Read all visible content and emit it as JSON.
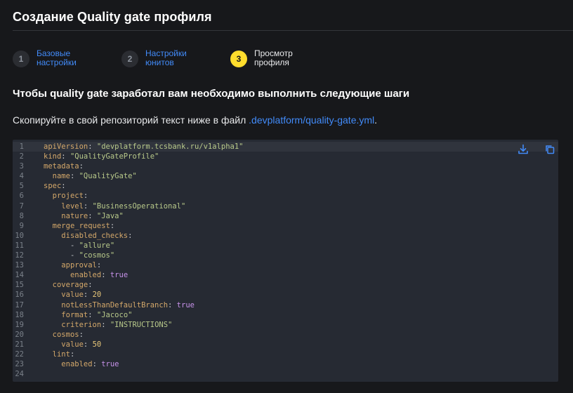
{
  "page": {
    "title": "Создание Quality gate профиля"
  },
  "stepper": {
    "steps": [
      {
        "number": "1",
        "label": "Базовые\nнастройки",
        "state": "completed"
      },
      {
        "number": "2",
        "label": "Настройки\nюнитов",
        "state": "completed"
      },
      {
        "number": "3",
        "label": "Просмотр\nпрофиля",
        "state": "active"
      }
    ]
  },
  "content": {
    "heading": "Чтобы quality gate заработал вам необходимо выполнить следующие шаги",
    "instruction_prefix": "Скопируйте в свой репозиторий текст ниже в файл ",
    "file_link": ".devplatform/quality-gate.yml",
    "instruction_suffix": "."
  },
  "code_block": {
    "actions": [
      {
        "name": "download-icon"
      },
      {
        "name": "copy-icon"
      }
    ],
    "lines": [
      {
        "n": "1",
        "indent": "",
        "key": "apiVersion",
        "value": "\"devplatform.tcsbank.ru/v1alpha1\"",
        "vtype": "s"
      },
      {
        "n": "2",
        "indent": "",
        "key": "kind",
        "value": "\"QualityGateProfile\"",
        "vtype": "s"
      },
      {
        "n": "3",
        "indent": "",
        "key": "metadata",
        "value": "",
        "vtype": ""
      },
      {
        "n": "4",
        "indent": "  ",
        "key": "name",
        "value": "\"QualityGate\"",
        "vtype": "s"
      },
      {
        "n": "5",
        "indent": "",
        "key": "spec",
        "value": "",
        "vtype": ""
      },
      {
        "n": "6",
        "indent": "  ",
        "key": "project",
        "value": "",
        "vtype": ""
      },
      {
        "n": "7",
        "indent": "    ",
        "key": "level",
        "value": "\"BusinessOperational\"",
        "vtype": "s"
      },
      {
        "n": "8",
        "indent": "    ",
        "key": "nature",
        "value": "\"Java\"",
        "vtype": "s"
      },
      {
        "n": "9",
        "indent": "  ",
        "key": "merge_request",
        "value": "",
        "vtype": ""
      },
      {
        "n": "10",
        "indent": "    ",
        "key": "disabled_checks",
        "value": "",
        "vtype": ""
      },
      {
        "n": "11",
        "indent": "      ",
        "key": "",
        "value": "\"allure\"",
        "vtype": "s",
        "item": true
      },
      {
        "n": "12",
        "indent": "      ",
        "key": "",
        "value": "\"cosmos\"",
        "vtype": "s",
        "item": true
      },
      {
        "n": "13",
        "indent": "    ",
        "key": "approval",
        "value": "",
        "vtype": ""
      },
      {
        "n": "14",
        "indent": "      ",
        "key": "enabled",
        "value": "true",
        "vtype": "b"
      },
      {
        "n": "15",
        "indent": "  ",
        "key": "coverage",
        "value": "",
        "vtype": ""
      },
      {
        "n": "16",
        "indent": "    ",
        "key": "value",
        "value": "20",
        "vtype": "n"
      },
      {
        "n": "17",
        "indent": "    ",
        "key": "notLessThanDefaultBranch",
        "value": "true",
        "vtype": "b"
      },
      {
        "n": "18",
        "indent": "    ",
        "key": "format",
        "value": "\"Jacoco\"",
        "vtype": "s"
      },
      {
        "n": "19",
        "indent": "    ",
        "key": "criterion",
        "value": "\"INSTRUCTIONS\"",
        "vtype": "s"
      },
      {
        "n": "20",
        "indent": "  ",
        "key": "cosmos",
        "value": "",
        "vtype": ""
      },
      {
        "n": "21",
        "indent": "    ",
        "key": "value",
        "value": "50",
        "vtype": "n"
      },
      {
        "n": "22",
        "indent": "  ",
        "key": "lint",
        "value": "",
        "vtype": ""
      },
      {
        "n": "23",
        "indent": "    ",
        "key": "enabled",
        "value": "true",
        "vtype": "b"
      },
      {
        "n": "24",
        "indent": "",
        "key": "",
        "value": "",
        "vtype": ""
      }
    ]
  },
  "colors": {
    "background": "#17181b",
    "accent_link": "#428bf9",
    "active_step": "#ffdd2d",
    "code_background": "#262a33"
  }
}
